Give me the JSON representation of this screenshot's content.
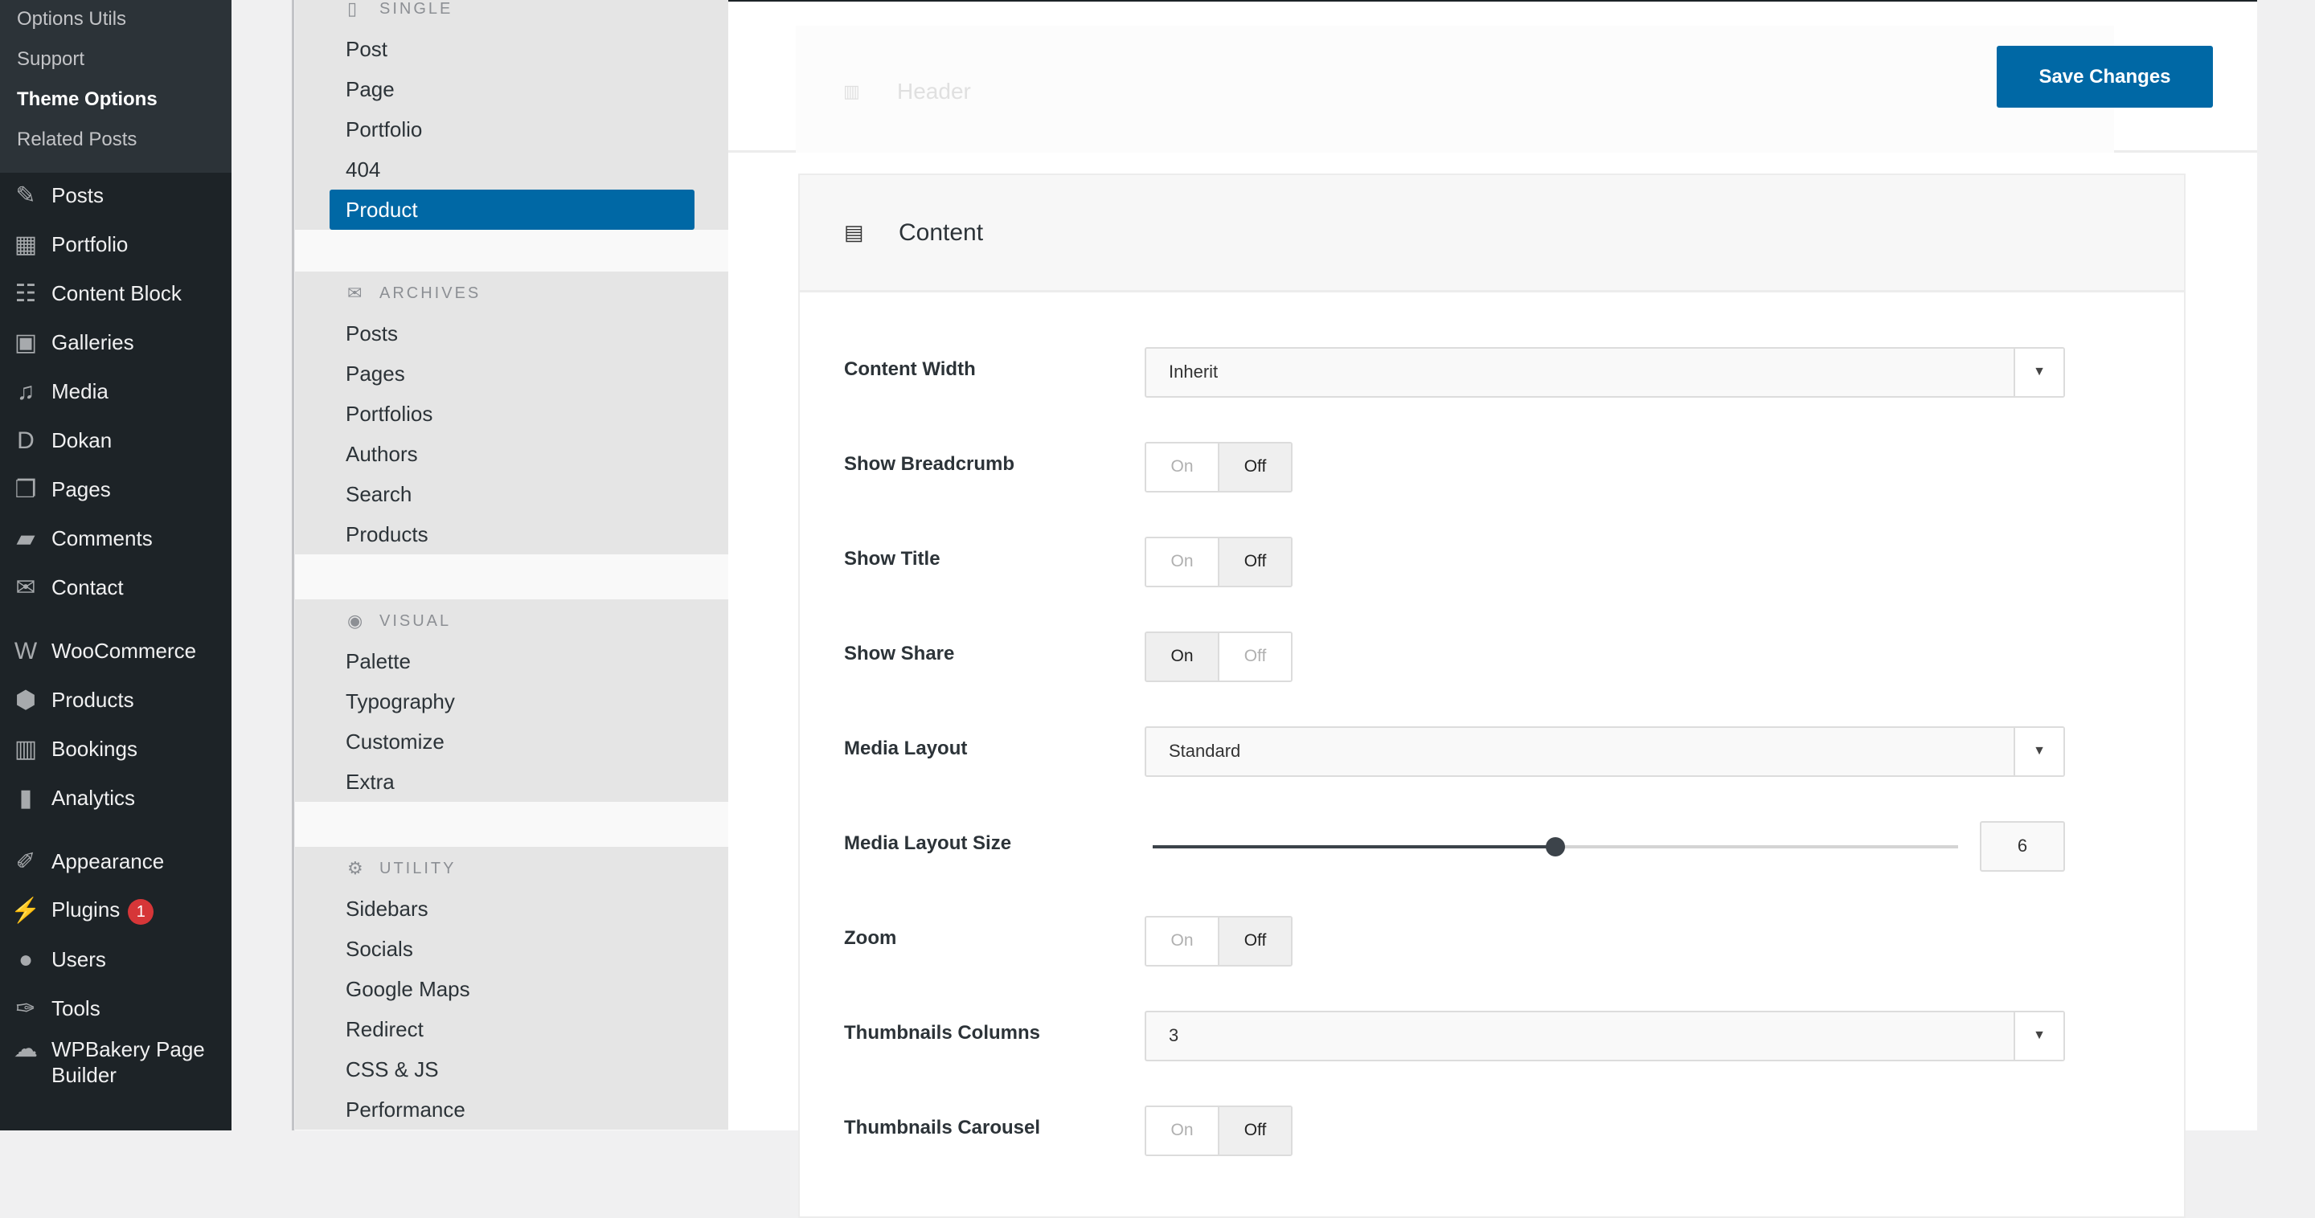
{
  "wp_submenu": [
    "Options Utils",
    "Support",
    "Theme Options",
    "Related Posts"
  ],
  "wp_submenu_current": "Theme Options",
  "wp_menu": [
    {
      "label": "Posts",
      "icon": "pin-icon"
    },
    {
      "label": "Portfolio",
      "icon": "portfolio-icon"
    },
    {
      "label": "Content Block",
      "icon": "content-block-icon"
    },
    {
      "label": "Galleries",
      "icon": "gallery-icon"
    },
    {
      "label": "Media",
      "icon": "media-icon"
    },
    {
      "label": "Dokan",
      "icon": "dokan-icon"
    },
    {
      "label": "Pages",
      "icon": "pages-icon"
    },
    {
      "label": "Comments",
      "icon": "comment-icon"
    },
    {
      "label": "Contact",
      "icon": "mail-icon"
    },
    {
      "label": "WooCommerce",
      "icon": "woo-icon"
    },
    {
      "label": "Products",
      "icon": "box-icon"
    },
    {
      "label": "Bookings",
      "icon": "calendar-icon"
    },
    {
      "label": "Analytics",
      "icon": "bar-chart-icon"
    },
    {
      "label": "Appearance",
      "icon": "brush-icon"
    },
    {
      "label": "Plugins",
      "icon": "plug-icon",
      "badge": "1"
    },
    {
      "label": "Users",
      "icon": "user-icon"
    },
    {
      "label": "Tools",
      "icon": "wrench-icon"
    },
    {
      "label": "WPBakery Page Builder",
      "icon": "cloud-icon"
    }
  ],
  "options_nav": [
    {
      "title": "SINGLE",
      "icon": "file-icon",
      "items": [
        "Post",
        "Page",
        "Portfolio",
        "404",
        "Product"
      ]
    },
    {
      "title": "ARCHIVES",
      "icon": "inbox-icon",
      "items": [
        "Posts",
        "Pages",
        "Portfolios",
        "Authors",
        "Search",
        "Products"
      ]
    },
    {
      "title": "VISUAL",
      "icon": "eye-icon",
      "items": [
        "Palette",
        "Typography",
        "Customize",
        "Extra"
      ]
    },
    {
      "title": "UTILITY",
      "icon": "gear-icon",
      "items": [
        "Sidebars",
        "Socials",
        "Google Maps",
        "Redirect",
        "CSS & JS",
        "Performance"
      ]
    }
  ],
  "options_nav_active": "Product",
  "header": {
    "title": "Header",
    "save_label": "Save Changes"
  },
  "section": {
    "title": "Content"
  },
  "toggle_labels": {
    "on": "On",
    "off": "Off"
  },
  "fields": [
    {
      "label": "Content Width",
      "type": "select",
      "value": "Inherit"
    },
    {
      "label": "Show Breadcrumb",
      "type": "toggle",
      "value": "Off"
    },
    {
      "label": "Show Title",
      "type": "toggle",
      "value": "Off"
    },
    {
      "label": "Show Share",
      "type": "toggle",
      "value": "On"
    },
    {
      "label": "Media Layout",
      "type": "select",
      "value": "Standard"
    },
    {
      "label": "Media Layout Size",
      "type": "slider",
      "value": "6",
      "fraction": 0.5
    },
    {
      "label": "Zoom",
      "type": "toggle",
      "value": "Off"
    },
    {
      "label": "Thumbnails Columns",
      "type": "select",
      "value": "3"
    },
    {
      "label": "Thumbnails Carousel",
      "type": "toggle",
      "value": "Off"
    }
  ],
  "colors": {
    "accent": "#0068a5",
    "admin_bar": "#1d2327",
    "badge": "#d63638"
  }
}
